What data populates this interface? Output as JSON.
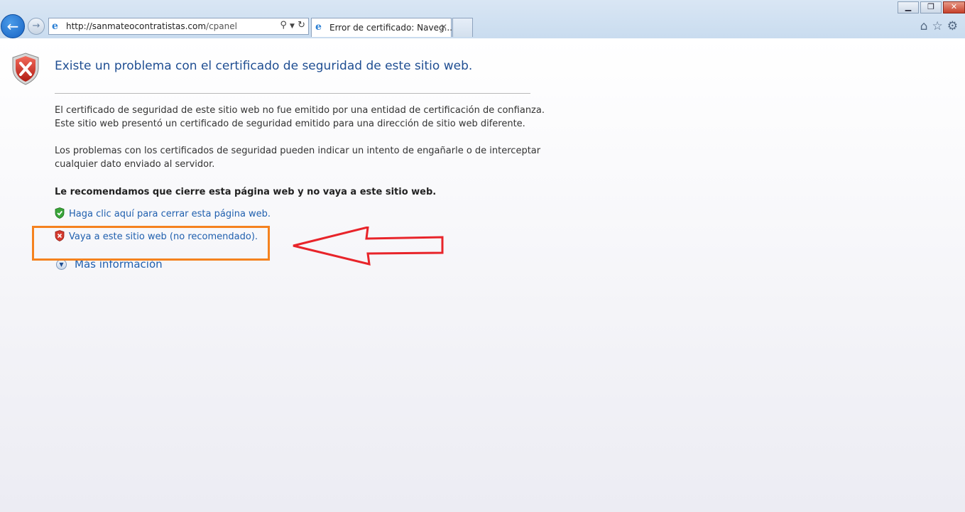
{
  "browser": {
    "address_url_host": "http://sanmateocontratistas.com",
    "address_url_path": "/cpanel",
    "tab_title": "Error de certificado: Naveg...",
    "tab_close": "✕",
    "win_minimize": "▁",
    "win_restore": "❐",
    "win_close": "✕",
    "toolbar_icons": [
      "home-icon",
      "favorites-star-icon",
      "settings-gear-icon"
    ]
  },
  "page": {
    "heading": "Existe un problema con el certificado de seguridad de este sitio web.",
    "para1_line1": "El certificado de seguridad de este sitio web no fue emitido por una entidad de certificación de confianza.",
    "para1_line2": "Este sitio web presentó un certificado de seguridad emitido para una dirección de sitio web diferente.",
    "para2_line1": "Los problemas con los certificados de seguridad pueden indicar un intento de engañarle o de interceptar",
    "para2_line2": "cualquier dato enviado al servidor.",
    "recommendation": "Le recomendamos que cierre esta página web y no vaya a este sitio web.",
    "close_link": "Haga clic aquí para cerrar esta página web.",
    "continue_link": "Vaya a este sitio web (no recomendado).",
    "more_info": "Más información"
  },
  "colors": {
    "heading": "#1f4e92",
    "link": "#1f5fae",
    "annotation_box": "#f5821f",
    "annotation_arrow": "#e8242a"
  }
}
